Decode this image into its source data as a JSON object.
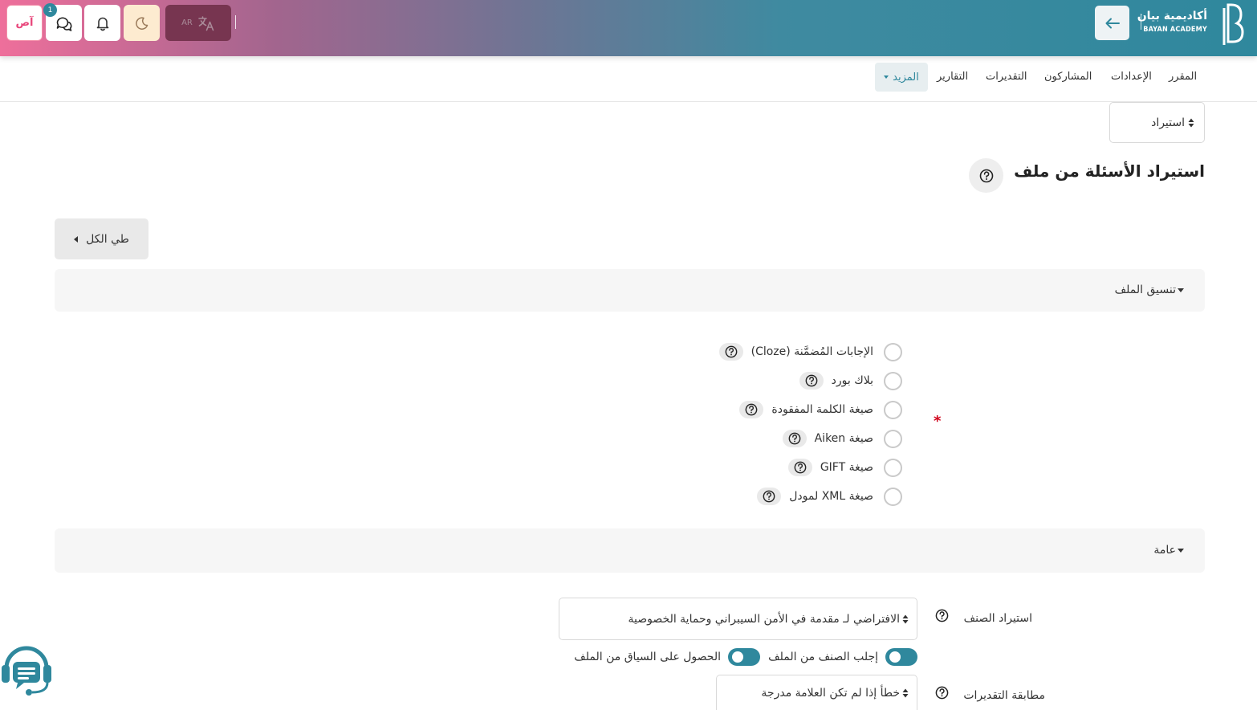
{
  "brand": {
    "name_ar": "أكاديمية بيان",
    "name_en": "BAYAN ACADEMY",
    "accent": "#2f889d"
  },
  "header": {
    "user_initials": "آص",
    "message_count": "1",
    "language_code": "AR",
    "icons": [
      "back-arrow-icon",
      "chat-icon",
      "bell-icon",
      "moon-icon",
      "translate-icon"
    ]
  },
  "nav": {
    "items": [
      "المقرر",
      "الإعدادات",
      "المشاركون",
      "التقديرات",
      "التقارير"
    ],
    "more_label": "المزيد"
  },
  "import_select": {
    "value": "استيراد"
  },
  "page": {
    "title": "استيراد الأسئلة من ملف",
    "collapse_all": "طي الكل"
  },
  "sections": {
    "file_format": {
      "title": "تنسيق الملف",
      "options": [
        "الإجابات المُضمَّنة (Cloze)",
        "بلاك بورد",
        "صيغة الكلمة المفقودة",
        "صيغة Aiken",
        "صيغة GIFT",
        "صيغة XML لمودل"
      ]
    },
    "general": {
      "title": "عامة",
      "import_category_label": "استيراد الصنف",
      "import_category_value": "الافتراضي لـ مقدمة في الأمن السيبراني وحماية الخصوصية",
      "toggle_category_from_file": "إجلب الصنف من الملف",
      "toggle_context_from_file": "الحصول على السياق من الملف",
      "grade_matching_label": "مطابقة التقديرات",
      "grade_matching_value": "خطأ إذا لم تكن العلامة مدرجة"
    }
  }
}
